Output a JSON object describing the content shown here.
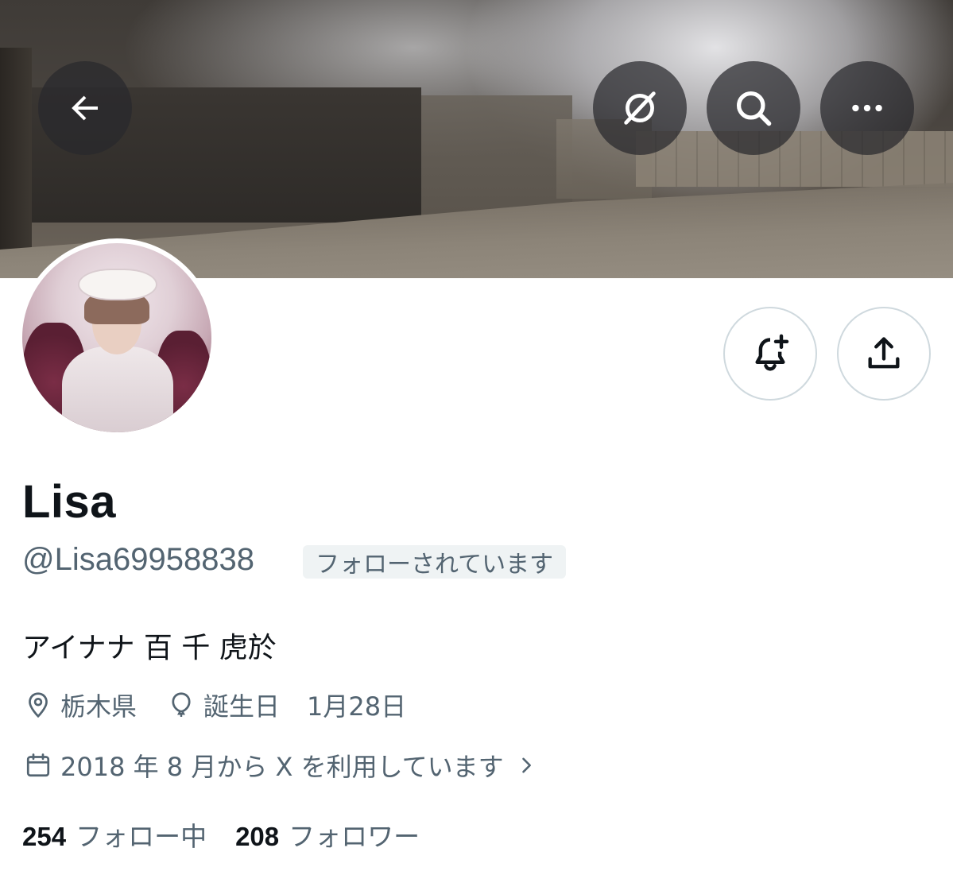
{
  "header": {
    "back_icon": "arrow-left-icon",
    "grok_icon": "grok-icon",
    "search_icon": "search-icon",
    "more_icon": "more-horizontal-icon"
  },
  "profile": {
    "display_name": "Lisa",
    "handle": "@Lisa69958838",
    "follows_you_label": "フォローされています",
    "bio": "アイナナ 百 千 虎於",
    "location": "栃木県",
    "birthday_label": "誕生日",
    "birthday_value": "1月28日",
    "joined": "2018 年 8 月から X を利用しています",
    "following_count": "254",
    "following_label": "フォロー中",
    "followers_count": "208",
    "followers_label": "フォロワー"
  },
  "actions": {
    "notify_icon": "bell-plus-icon",
    "share_icon": "share-upload-icon"
  },
  "colors": {
    "text_primary": "#0f1419",
    "text_secondary": "#536471",
    "badge_bg": "#eff3f4",
    "border": "#cfd9de"
  }
}
